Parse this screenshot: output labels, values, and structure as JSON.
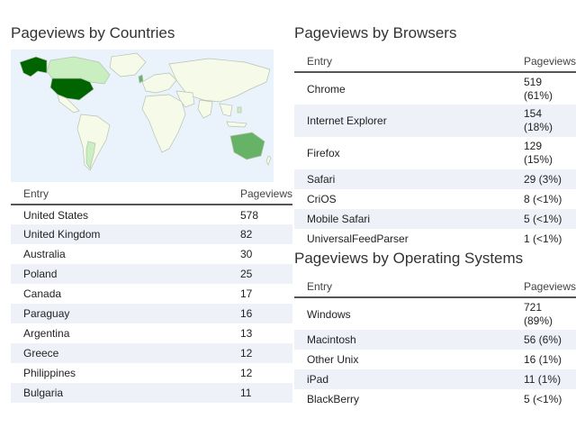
{
  "countries": {
    "title": "Pageviews by Countries",
    "columns": [
      "Entry",
      "Pageviews"
    ],
    "rows": [
      {
        "entry": "United States",
        "views": "578"
      },
      {
        "entry": "United Kingdom",
        "views": "82"
      },
      {
        "entry": "Australia",
        "views": "30"
      },
      {
        "entry": "Poland",
        "views": "25"
      },
      {
        "entry": "Canada",
        "views": "17"
      },
      {
        "entry": "Paraguay",
        "views": "16"
      },
      {
        "entry": "Argentina",
        "views": "13"
      },
      {
        "entry": "Greece",
        "views": "12"
      },
      {
        "entry": "Philippines",
        "views": "12"
      },
      {
        "entry": "Bulgaria",
        "views": "11"
      }
    ]
  },
  "browsers": {
    "title": "Pageviews by Browsers",
    "columns": [
      "Entry",
      "Pageviews"
    ],
    "rows": [
      {
        "entry": "Chrome",
        "views": "519",
        "pct": "(61%)"
      },
      {
        "entry": "Internet Explorer",
        "views": "154",
        "pct": "(18%)"
      },
      {
        "entry": "Firefox",
        "views": "129",
        "pct": "(15%)"
      },
      {
        "entry": "Safari",
        "views": "29 (3%)",
        "pct": ""
      },
      {
        "entry": "CriOS",
        "views": "8 (<1%)",
        "pct": ""
      },
      {
        "entry": "Mobile Safari",
        "views": "5 (<1%)",
        "pct": ""
      },
      {
        "entry": "UniversalFeedParser",
        "views": "1 (<1%)",
        "pct": ""
      }
    ]
  },
  "os": {
    "title": "Pageviews by Operating Systems",
    "columns": [
      "Entry",
      "Pageviews"
    ],
    "rows": [
      {
        "entry": "Windows",
        "views": "721",
        "pct": "(89%)"
      },
      {
        "entry": "Macintosh",
        "views": "56 (6%)",
        "pct": ""
      },
      {
        "entry": "Other Unix",
        "views": "16 (1%)",
        "pct": ""
      },
      {
        "entry": "iPad",
        "views": "11 (1%)",
        "pct": ""
      },
      {
        "entry": "BlackBerry",
        "views": "5 (<1%)",
        "pct": ""
      }
    ]
  },
  "map_colors": {
    "ocean": "#eaf2fb",
    "land": "#f6fbe9",
    "border": "#b8c2b0",
    "high": "#006400",
    "mid": "#66b266",
    "low": "#c9eec0"
  }
}
